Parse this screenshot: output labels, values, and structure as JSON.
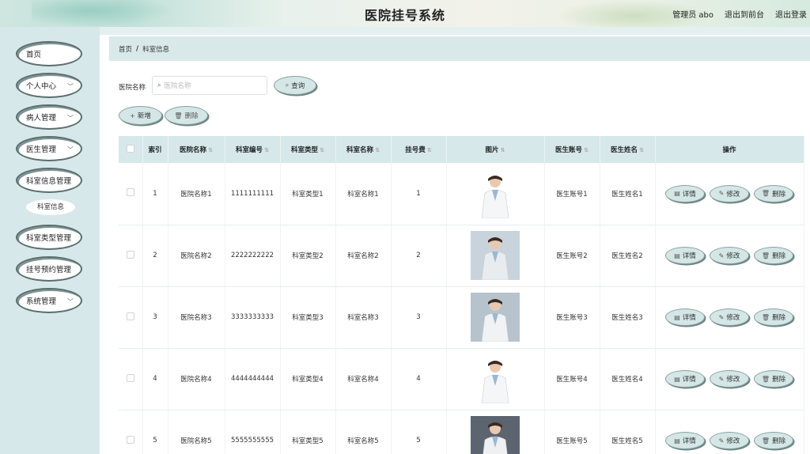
{
  "header": {
    "title": "医院挂号系统",
    "user_label": "管理员 abo",
    "front_label": "退出到前台",
    "logout_label": "退出登录"
  },
  "sidebar": {
    "items": [
      {
        "label": "首页",
        "expandable": false
      },
      {
        "label": "个人中心",
        "expandable": true
      },
      {
        "label": "病人管理",
        "expandable": true
      },
      {
        "label": "医生管理",
        "expandable": true
      },
      {
        "label": "科室信息管理",
        "expandable": false
      },
      {
        "label": "科室类型管理",
        "expandable": false
      },
      {
        "label": "挂号预约管理",
        "expandable": false
      },
      {
        "label": "系统管理",
        "expandable": true
      }
    ],
    "submenu_label": "科室信息"
  },
  "breadcrumb": {
    "home": "首页",
    "sep": "/",
    "current": "科室信息"
  },
  "search": {
    "label": "医院名称",
    "placeholder": "医院名称",
    "button": "查询"
  },
  "toolbar": {
    "add": "新增",
    "delete": "删除"
  },
  "table": {
    "headers": [
      "索引",
      "医院名称",
      "科室编号",
      "科室类型",
      "科室名称",
      "挂号费",
      "图片",
      "医生账号",
      "医生姓名",
      "操作"
    ],
    "rows": [
      {
        "index": "1",
        "hospital": "医院名称1",
        "dept_no": "1111111111",
        "dept_type": "科室类型1",
        "dept_name": "科室名称1",
        "fee": "1",
        "doctor_acc": "医生账号1",
        "doctor_name": "医生姓名1"
      },
      {
        "index": "2",
        "hospital": "医院名称2",
        "dept_no": "2222222222",
        "dept_type": "科室类型2",
        "dept_name": "科室名称2",
        "fee": "2",
        "doctor_acc": "医生账号2",
        "doctor_name": "医生姓名2"
      },
      {
        "index": "3",
        "hospital": "医院名称3",
        "dept_no": "3333333333",
        "dept_type": "科室类型3",
        "dept_name": "科室名称3",
        "fee": "3",
        "doctor_acc": "医生账号3",
        "doctor_name": "医生姓名3"
      },
      {
        "index": "4",
        "hospital": "医院名称4",
        "dept_no": "4444444444",
        "dept_type": "科室类型4",
        "dept_name": "科室名称4",
        "fee": "4",
        "doctor_acc": "医生账号4",
        "doctor_name": "医生姓名4"
      },
      {
        "index": "5",
        "hospital": "医院名称5",
        "dept_no": "5555555555",
        "dept_type": "科室类型5",
        "dept_name": "科室名称5",
        "fee": "5",
        "doctor_acc": "医生账号5",
        "doctor_name": "医生姓名5"
      }
    ],
    "actions": {
      "detail": "详情",
      "edit": "修改",
      "delete": "删除"
    }
  },
  "colors": {
    "accent": "#d6e8ea",
    "button_bg": "#d4e6e6",
    "border": "#5a6e6e"
  }
}
